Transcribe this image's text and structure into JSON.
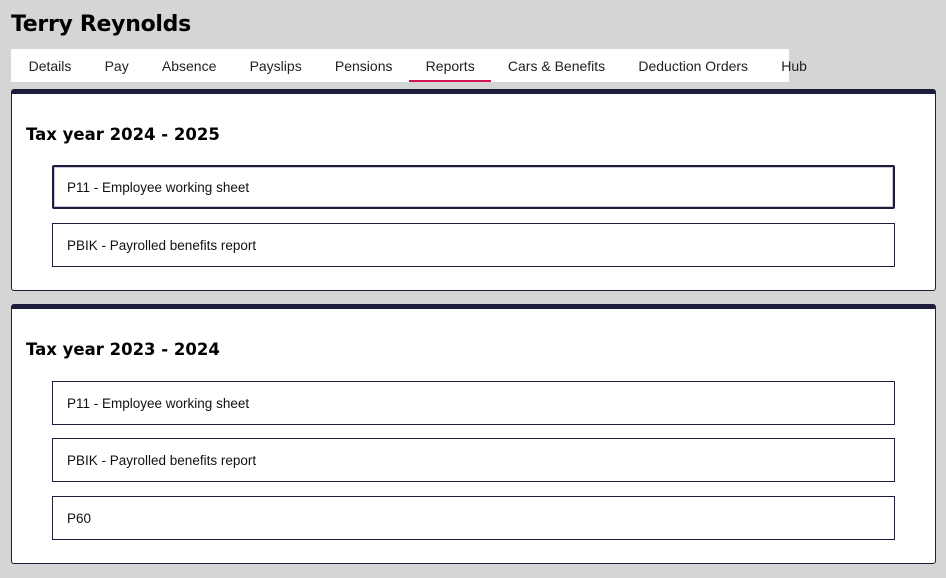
{
  "employee": {
    "name": "Terry Reynolds"
  },
  "tabs": [
    {
      "label": "Details"
    },
    {
      "label": "Pay"
    },
    {
      "label": "Absence"
    },
    {
      "label": "Payslips"
    },
    {
      "label": "Pensions"
    },
    {
      "label": "Reports",
      "active": true
    },
    {
      "label": "Cars & Benefits"
    },
    {
      "label": "Deduction Orders"
    },
    {
      "label": "Hub"
    }
  ],
  "tax_years": [
    {
      "title": "Tax year 2024 - 2025",
      "reports": [
        {
          "label": "P11 - Employee working sheet",
          "focused": true
        },
        {
          "label": "PBIK - Payrolled benefits report"
        }
      ]
    },
    {
      "title": "Tax year 2023 - 2024",
      "reports": [
        {
          "label": "P11 - Employee working sheet"
        },
        {
          "label": "PBIK - Payrolled benefits report"
        },
        {
          "label": "P60"
        }
      ]
    }
  ],
  "colors": {
    "background": "#d4d5d5",
    "panel_border": "#1d1c3c",
    "active_tab_underline": "#d4145a"
  }
}
